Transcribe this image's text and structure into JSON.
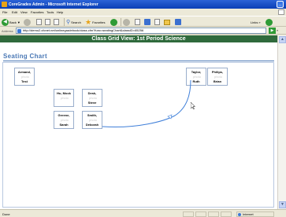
{
  "window": {
    "title": "CoreGrades Admin - Microsoft Internet Explorer",
    "menu": [
      "File",
      "Edit",
      "View",
      "Favorites",
      "Tools",
      "Help"
    ]
  },
  "toolbar": {
    "back_label": "Back",
    "search_label": "Search",
    "favorites_label": "Favorites",
    "links_label": "Links"
  },
  "address": {
    "label": "Address",
    "url": "http://demo2.cfcnet.net/onlinegradebook/class.cfm?func=seatingChart&classID=65256",
    "go_label": "Go",
    "links_label": "Links"
  },
  "page": {
    "banner": "Class Grid View: 1st Period Science",
    "title": "Seating Chart"
  },
  "seats": [
    {
      "last": "Armand,",
      "first": "Test",
      "photo": "photo"
    },
    {
      "last": "Taylor,",
      "first": "Ruth",
      "photo": "photo"
    },
    {
      "last": "Philips,",
      "first": "Brian",
      "photo": "photo"
    },
    {
      "last": "Hu, Mock",
      "first": "",
      "photo": "photo"
    },
    {
      "last": "Desk,",
      "first": "Steve",
      "photo": "photo"
    },
    {
      "last": "Greene,",
      "first": "Sarah",
      "photo": "photo"
    },
    {
      "last": "Smith,",
      "first": "Deborah",
      "photo": "photo"
    }
  ],
  "status": {
    "left": "Done",
    "zone": "Internet"
  },
  "colors": {
    "banner": "#2f6a3c",
    "title": "#4a78b5",
    "drag_line": "#3f7fd9"
  }
}
